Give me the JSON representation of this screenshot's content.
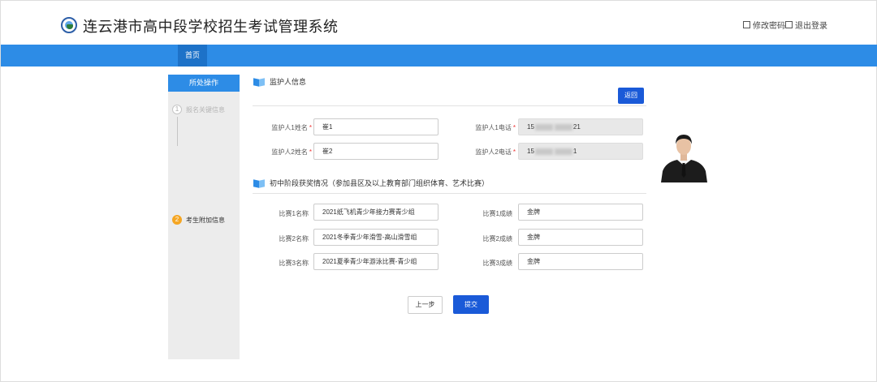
{
  "header": {
    "system_title": "连云港市高中段学校招生考试管理系统",
    "change_password": "修改密码",
    "logout": "退出登录"
  },
  "nav": {
    "home": "首页"
  },
  "sidebar": {
    "heading": "所处操作",
    "steps": [
      {
        "num": "1",
        "label": "报名关键信息"
      },
      {
        "num": "2",
        "label": "考生附加信息"
      }
    ]
  },
  "guardian": {
    "section_title": "监护人信息",
    "back_button": "返回",
    "fields": [
      {
        "label": "监护人1姓名",
        "value": "崔1"
      },
      {
        "label": "监护人2姓名",
        "value": "崔2"
      },
      {
        "label": "监护人1电话",
        "prefix": "15",
        "suffix": "21"
      },
      {
        "label": "监护人2电话",
        "prefix": "15",
        "suffix": "1"
      }
    ]
  },
  "awards": {
    "section_title": "初中阶段获奖情况（参加县区及以上教育部门组织体育、艺术比赛）",
    "rows": [
      {
        "name_label": "比赛1名称",
        "name": "2021纸飞机青少年接力赛青少组",
        "result_label": "比赛1成绩",
        "result": "金牌"
      },
      {
        "name_label": "比赛2名称",
        "name": "2021冬季青少年滑雪-高山滑雪组",
        "result_label": "比赛2成绩",
        "result": "金牌"
      },
      {
        "name_label": "比赛3名称",
        "name": "2021夏季青少年游泳比赛-青少组",
        "result_label": "比赛3成绩",
        "result": "金牌"
      }
    ]
  },
  "actions": {
    "prev": "上一步",
    "submit": "提交"
  },
  "colors": {
    "primary": "#2d8ce6",
    "button": "#1a5ad8",
    "step_active": "#f5a623",
    "required": "#e33333"
  }
}
